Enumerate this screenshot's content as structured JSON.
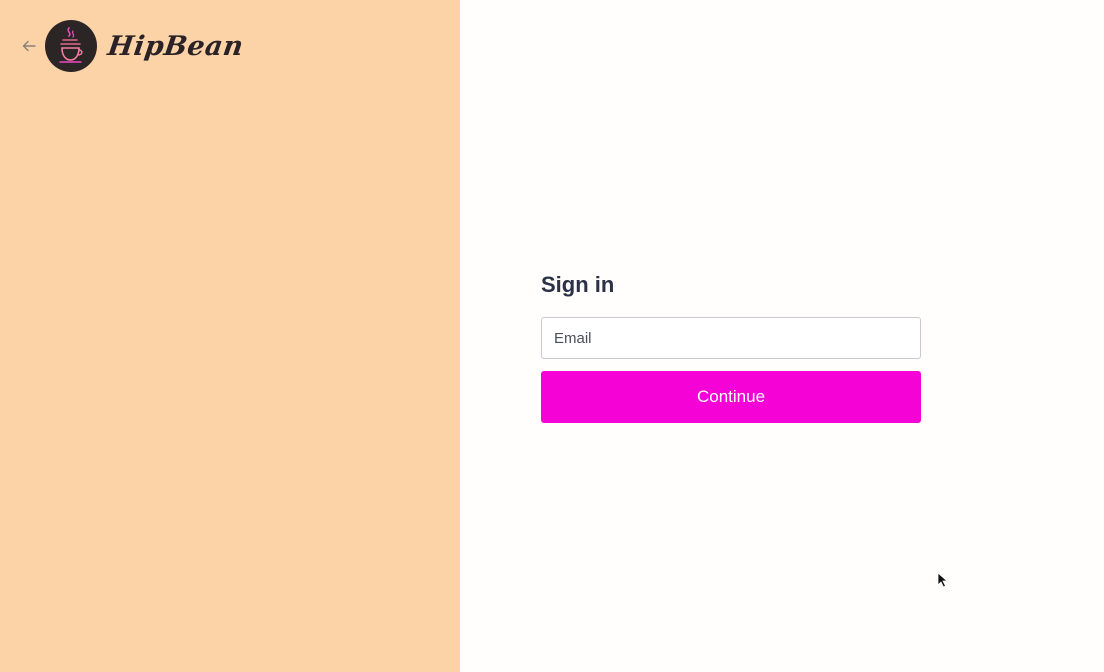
{
  "brand": {
    "name": "HipBean",
    "logo_icon": "coffee-cup-icon"
  },
  "nav": {
    "back_icon": "arrow-left-icon"
  },
  "signin": {
    "title": "Sign in",
    "email_placeholder": "Email",
    "email_value": "",
    "continue_label": "Continue"
  },
  "colors": {
    "left_panel_bg": "#fbd3a6",
    "accent": "#f502d6",
    "title_text": "#2b3147",
    "logo_bg": "#2b2526"
  }
}
